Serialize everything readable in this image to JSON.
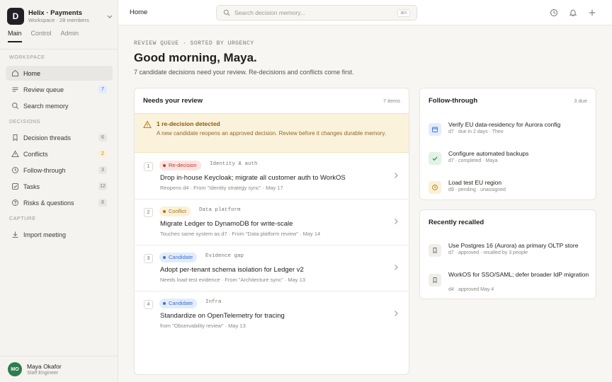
{
  "workspace": {
    "initial": "D",
    "name": "Helix · Payments",
    "sub": "Workspace · 28 members"
  },
  "topnav": [
    "Main",
    "Control",
    "Admin"
  ],
  "sidebar": {
    "section_workspace": "WORKSPACE",
    "section_decisions": "DECISIONS",
    "section_capture": "CAPTURE",
    "items": [
      {
        "label": "Home",
        "icon": "home-icon"
      },
      {
        "label": "Review queue",
        "count": "7",
        "icon": "list-icon"
      },
      {
        "label": "Search memory",
        "icon": "search-icon"
      },
      {
        "label": "Decision threads",
        "count": "6",
        "icon": "bookmark-icon"
      },
      {
        "label": "Conflicts",
        "count": "2",
        "icon": "warning-icon"
      },
      {
        "label": "Follow-through",
        "count": "3",
        "icon": "clock-icon"
      },
      {
        "label": "Tasks",
        "count": "12",
        "icon": "checkbox-icon"
      },
      {
        "label": "Risks & questions",
        "count": "8",
        "icon": "question-icon"
      },
      {
        "label": "Import meeting",
        "icon": "download-icon"
      }
    ]
  },
  "user": {
    "initials": "MO",
    "name": "Maya Okafor",
    "role": "Staff Engineer"
  },
  "header": {
    "title": "Home",
    "search_placeholder": "Search decision memory...",
    "shortcut": "⌘K"
  },
  "main": {
    "kicker": "REVIEW QUEUE · SORTED BY URGENCY",
    "greeting": "Good morning, Maya.",
    "subtitle": "7 candidate decisions need your review. Re-decisions and conflicts come first."
  },
  "review": {
    "title": "Needs your review",
    "count": "7 items",
    "alert": {
      "title": "1 re-decision detected",
      "text": "A new candidate reopens an approved decision. Review before it changes durable memory."
    },
    "rows": [
      {
        "num": "1",
        "tag": "Re-decision",
        "topic": "Identity & auth",
        "title": "Drop in-house Keycloak; migrate all customer auth to WorkOS",
        "meta": "Reopens d4 · From \"Identity strategy sync\" · May 17"
      },
      {
        "num": "2",
        "tag": "Conflict",
        "topic": "Data platform",
        "title": "Migrate Ledger to DynamoDB for write-scale",
        "meta": "Touches same system as d7 · From \"Data platform review\" · May 14"
      },
      {
        "num": "3",
        "tag": "Candidate",
        "topic": "Evidence gap",
        "title": "Adopt per-tenant schema isolation for Ledger v2",
        "meta": "Needs load-test evidence · From \"Architecture sync\" · May 13"
      },
      {
        "num": "4",
        "tag": "Candidate",
        "topic": "Infra",
        "title": "Standardize on OpenTelemetry for tracing",
        "meta": "from \"Observability review\" · May 13"
      }
    ]
  },
  "follow": {
    "title": "Follow-through",
    "count": "3 due",
    "items": [
      {
        "title": "Verify EU data-residency for Aurora config",
        "meta": "d7 · due in 2 days · Theo",
        "icon": "calendar-icon"
      },
      {
        "title": "Configure automated backups",
        "meta": "d7 · completed · Maya",
        "icon": "check-icon"
      },
      {
        "title": "Load test EU region",
        "meta": "d9 · pending · unassigned",
        "icon": "clock-icon"
      }
    ]
  },
  "recalled": {
    "title": "Recently recalled",
    "items": [
      {
        "title": "Use Postgres 16 (Aurora) as primary OLTP store",
        "meta": "d7 · approved · recalled by 3 people",
        "icon": "bookmark-icon"
      },
      {
        "title": "WorkOS for SSO/SAML; defer broader IdP migration",
        "meta": "d4 · approved May 4",
        "icon": "bookmark-icon"
      }
    ]
  },
  "colors": {
    "accent_blue": "#3a6fd8",
    "amber": "#b7821f",
    "red": "#c23b2b",
    "green": "#2e7d4f"
  }
}
